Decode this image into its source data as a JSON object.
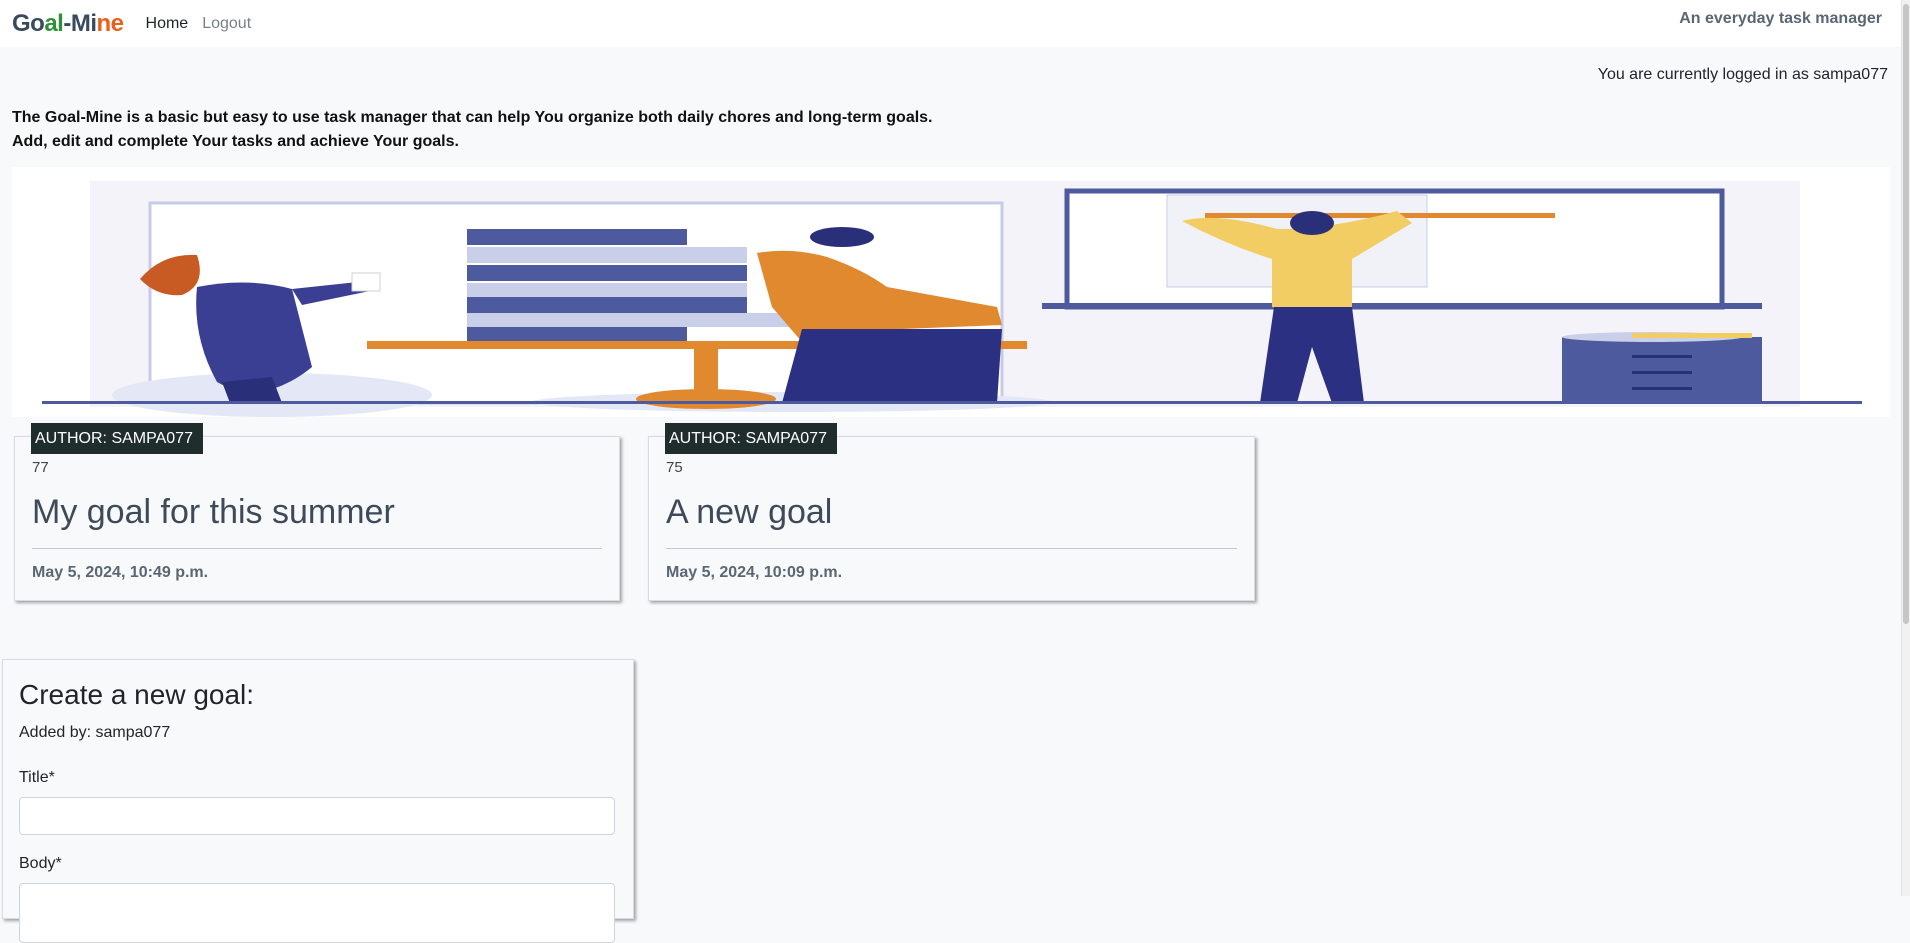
{
  "navbar": {
    "brand": {
      "part1": "Go",
      "part2": "al",
      "part3": "-Mi",
      "part4": "ne"
    },
    "links": [
      {
        "label": "Home"
      },
      {
        "label": "Logout"
      }
    ],
    "tagline": "An everyday task manager"
  },
  "status": {
    "logged_in_text": "You are currently logged in as sampa077"
  },
  "intro": {
    "line1": "The Goal-Mine is a basic but easy to use task manager that can help You organize both daily chores and long-term goals.",
    "line2": "Add, edit and complete Your tasks and achieve Your goals."
  },
  "goals": [
    {
      "author": "AUTHOR: SAMPA077",
      "id": "77",
      "title": "My goal for this summer",
      "date": "May 5, 2024, 10:49 p.m."
    },
    {
      "author": "AUTHOR: SAMPA077",
      "id": "75",
      "title": "A new goal",
      "date": "May 5, 2024, 10:09 p.m."
    }
  ],
  "create_form": {
    "heading": "Create a new goal:",
    "added_by": "Added by: sampa077",
    "title_label": "Title*",
    "title_value": "",
    "body_label": "Body*",
    "body_value": ""
  }
}
